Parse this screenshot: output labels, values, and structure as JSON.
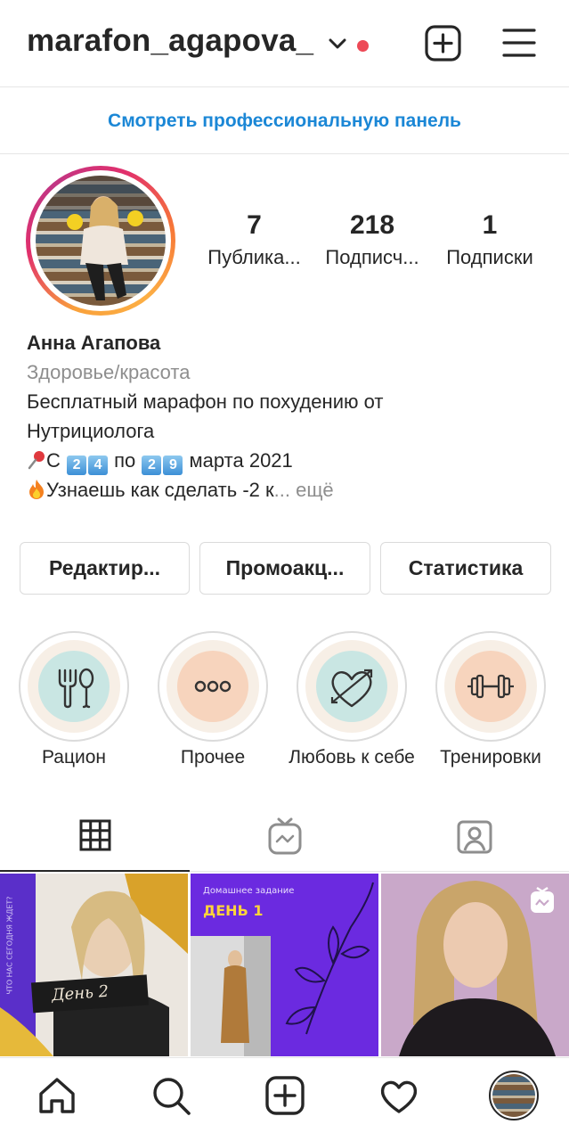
{
  "header": {
    "username": "marafon_agapova_"
  },
  "pro_panel": {
    "label": "Смотреть профессиональную панель"
  },
  "profile": {
    "stats": [
      {
        "count": "7",
        "label": "Публика..."
      },
      {
        "count": "218",
        "label": "Подписч..."
      },
      {
        "count": "1",
        "label": "Подписки"
      }
    ],
    "name": "Анна Агапова",
    "category": "Здоровье/красота",
    "bio_line1": "Бесплатный марафон по похудению от",
    "bio_line2": "Нутрициолога",
    "bio_line3_prefix": "С",
    "bio_date_from": [
      "2",
      "4"
    ],
    "bio_line3_mid": "по",
    "bio_date_to": [
      "2",
      "9"
    ],
    "bio_line3_suffix": "марта 2021",
    "bio_line4": "Узнаешь как сделать -2 к",
    "more_label": "... ещё"
  },
  "actions": {
    "edit_label": "Редактир...",
    "promo_label": "Промоакц...",
    "stats_label": "Статистика"
  },
  "highlights": [
    {
      "label": "Рацион",
      "icon": "fork-spoon-icon",
      "color": "#c9e6e3"
    },
    {
      "label": "Прочее",
      "icon": "three-dots-icon",
      "color": "#f7d4bd"
    },
    {
      "label": "Любовь к себе",
      "icon": "heart-arrow-icon",
      "color": "#c9e6e3"
    },
    {
      "label": "Тренировки",
      "icon": "dumbbell-icon",
      "color": "#f7d4bd"
    }
  ],
  "posts": [
    {
      "caption": "День 2",
      "side_text": "ЧТО НАС СЕГОДНЯ ЖДЕТ?"
    },
    {
      "caption": "ДЕНЬ 1",
      "subtitle": "Домашнее задание"
    },
    {
      "caption": ""
    }
  ],
  "colors": {
    "link_blue": "#1b87d6",
    "notification_red": "#ed4956",
    "post_purple": "#6b2ae0"
  }
}
